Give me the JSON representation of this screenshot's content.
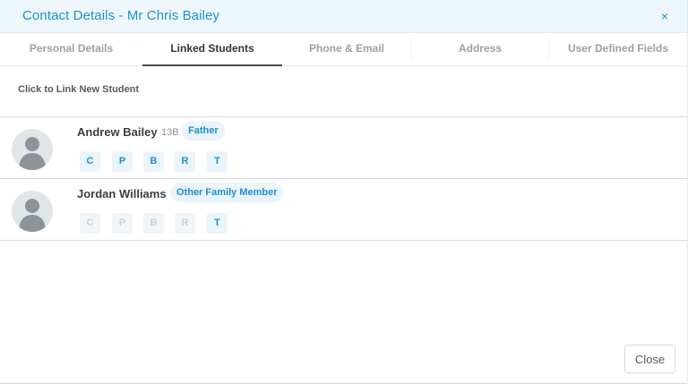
{
  "dialog": {
    "title": "Contact Details - Mr Chris Bailey",
    "close_icon": "×",
    "close_button": "Close"
  },
  "tabs": [
    {
      "label": "Personal Details",
      "active": false
    },
    {
      "label": "Linked Students",
      "active": true
    },
    {
      "label": "Phone & Email",
      "active": false
    },
    {
      "label": "Address",
      "active": false
    },
    {
      "label": "User Defined Fields",
      "active": false
    }
  ],
  "link_new_student": "Click to Link New Student",
  "students": [
    {
      "name": "Andrew Bailey",
      "year": "13B",
      "relationship": "Father",
      "permissions": [
        {
          "label": "C",
          "enabled": true
        },
        {
          "label": "P",
          "enabled": true
        },
        {
          "label": "B",
          "enabled": true
        },
        {
          "label": "R",
          "enabled": true
        },
        {
          "label": "T",
          "enabled": true
        }
      ]
    },
    {
      "name": "Jordan Williams",
      "year": "",
      "relationship": "Other Family Member",
      "permissions": [
        {
          "label": "C",
          "enabled": false
        },
        {
          "label": "P",
          "enabled": false
        },
        {
          "label": "B",
          "enabled": false
        },
        {
          "label": "R",
          "enabled": false
        },
        {
          "label": "T",
          "enabled": true
        }
      ]
    }
  ],
  "colors": {
    "accent": "#1f8fce",
    "header_bg": "#eef7fc",
    "badge_bg": "#eaf4fb",
    "disabled_text": "#c6d3dc"
  }
}
